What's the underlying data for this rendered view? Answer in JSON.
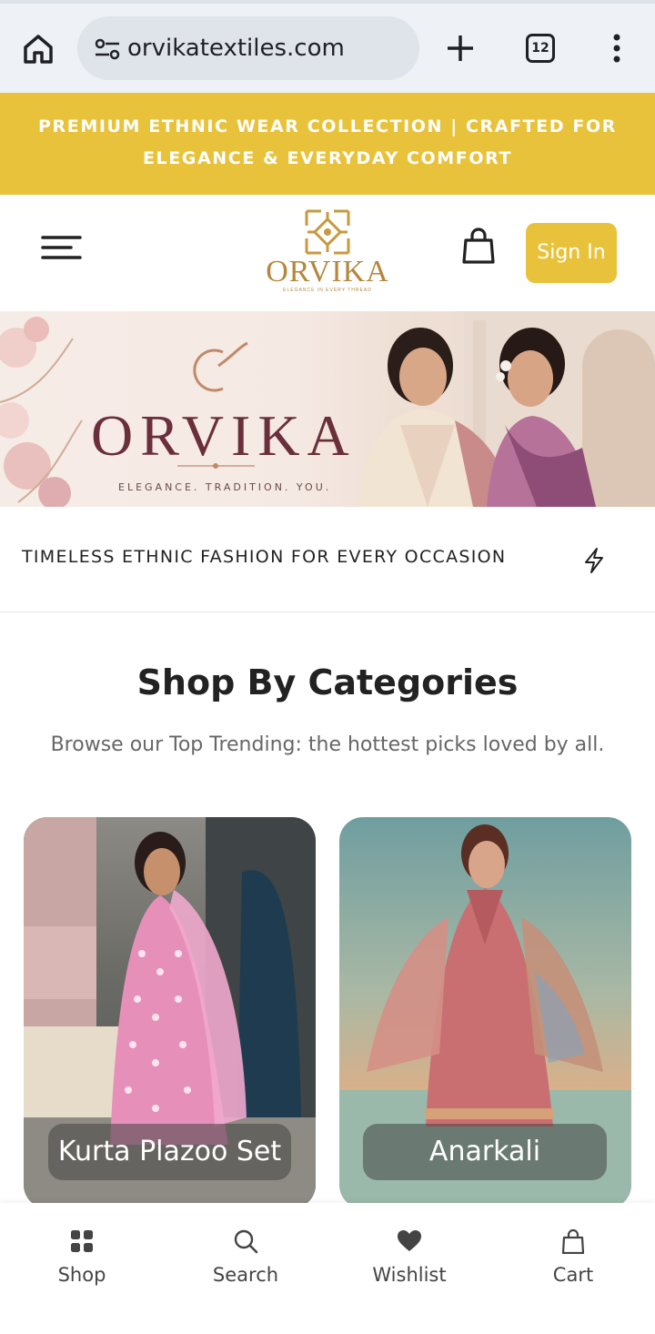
{
  "browser": {
    "url": "orvikatextiles.com",
    "tab_count": "12"
  },
  "announcement": {
    "text": "PREMIUM ETHNIC WEAR COLLECTION | CRAFTED FOR ELEGANCE & EVERYDAY COMFORT"
  },
  "header": {
    "logo_word": "ORVIKA",
    "logo_tagline": "ELEGANCE IN EVERY THREAD",
    "signin_label": "Sign In"
  },
  "hero": {
    "brand": "ORVIKA",
    "tagline": "ELEGANCE. TRADITION. YOU."
  },
  "ticker": {
    "text": "TIMELESS ETHNIC FASHION FOR EVERY OCCASION"
  },
  "categories": {
    "title": "Shop By Categories",
    "subtitle": "Browse our Top Trending: the hottest picks loved by all.",
    "items": [
      {
        "label": "Kurta Plazoo Set"
      },
      {
        "label": "Anarkali"
      }
    ]
  },
  "bottom_nav": {
    "items": [
      {
        "label": "Shop",
        "icon": "grid-icon"
      },
      {
        "label": "Search",
        "icon": "search-icon"
      },
      {
        "label": "Wishlist",
        "icon": "heart-icon"
      },
      {
        "label": "Cart",
        "icon": "cart-icon"
      }
    ]
  },
  "colors": {
    "accent": "#e9c23b",
    "brand_gold": "#b5863b",
    "hero_text": "#6a2f3b"
  }
}
